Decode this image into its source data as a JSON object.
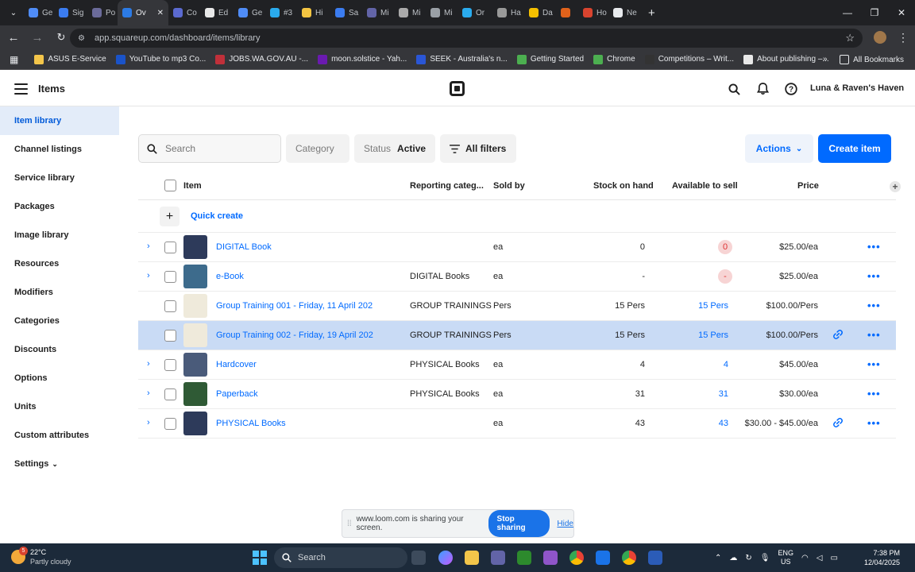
{
  "browser": {
    "tabs": [
      {
        "label": "Ge",
        "color": "#4f8cf7"
      },
      {
        "label": "Sig",
        "color": "#3b7cf0"
      },
      {
        "label": "Po",
        "color": "#6b6b9a"
      },
      {
        "label": "Ov",
        "color": "#2c7be5",
        "active": true
      },
      {
        "label": "Co",
        "color": "#5b6ad0"
      },
      {
        "label": "Ed",
        "color": "#e8e8e8"
      },
      {
        "label": "Ge",
        "color": "#4f8cf7"
      },
      {
        "label": "#3",
        "color": "#2aabee"
      },
      {
        "label": "Hi",
        "color": "#f4c542"
      },
      {
        "label": "Sa",
        "color": "#3b7cf0"
      },
      {
        "label": "Mi",
        "color": "#6264a7"
      },
      {
        "label": "Mi",
        "color": "#aaaaaa"
      },
      {
        "label": "Mi",
        "color": "#9aa0a6"
      },
      {
        "label": "Or",
        "color": "#2aabee"
      },
      {
        "label": "Ha",
        "color": "#999999"
      },
      {
        "label": "Da",
        "color": "#f5c000"
      },
      {
        "label": "",
        "color": "#e0621b"
      },
      {
        "label": "Ho",
        "color": "#d9442f"
      },
      {
        "label": "Ne",
        "color": "#e8eaed"
      }
    ],
    "new_tab": "+",
    "window_controls": [
      "—",
      "❐",
      "✕"
    ],
    "url": "app.squareup.com/dashboard/items/library",
    "bookmarks": [
      {
        "label": "ASUS E-Service",
        "icon": "folder-icon",
        "color": "#f3c54a"
      },
      {
        "label": "YouTube to mp3 Co...",
        "icon": "app-icon",
        "color": "#1a53c9"
      },
      {
        "label": "JOBS.WA.GOV.AU -...",
        "icon": "wa-icon",
        "color": "#c0303a"
      },
      {
        "label": "moon.solstice - Yah...",
        "icon": "yahoo-icon",
        "color": "#6a1ab0"
      },
      {
        "label": "SEEK - Australia's n...",
        "icon": "seek-icon",
        "color": "#2a56d6"
      },
      {
        "label": "Getting Started",
        "icon": "chrome-icon",
        "color": "#4caf50"
      },
      {
        "label": "Chrome",
        "icon": "chrome-icon",
        "color": "#4caf50"
      },
      {
        "label": "Competitions – Writ...",
        "icon": "comp-icon",
        "color": "#333333"
      },
      {
        "label": "About publishing –...",
        "icon": "pub-icon",
        "color": "#e8e8e8"
      }
    ],
    "bookmarks_overflow": "»",
    "all_bookmarks": "All Bookmarks"
  },
  "header": {
    "title": "Items",
    "business_name": "Luna & Raven's Haven"
  },
  "sidebar": {
    "items": [
      {
        "label": "Item library",
        "active": true
      },
      {
        "label": "Channel listings"
      },
      {
        "label": "Service library"
      },
      {
        "label": "Packages"
      },
      {
        "label": "Image library"
      },
      {
        "label": "Resources"
      },
      {
        "label": "Modifiers"
      },
      {
        "label": "Categories"
      },
      {
        "label": "Discounts"
      },
      {
        "label": "Options"
      },
      {
        "label": "Units"
      },
      {
        "label": "Custom attributes"
      },
      {
        "label": "Settings",
        "caret": "⌄"
      }
    ]
  },
  "toolbar": {
    "search_placeholder": "Search",
    "category_label": "Category",
    "status_label": "Status",
    "status_value": "Active",
    "all_filters_label": "All filters",
    "actions_label": "Actions",
    "create_label": "Create item"
  },
  "table": {
    "columns": {
      "item": "Item",
      "reporting": "Reporting categ...",
      "sold_by": "Sold by",
      "stock": "Stock on hand",
      "available": "Available to sell",
      "price": "Price"
    },
    "quick_create": "Quick create",
    "rows": [
      {
        "name": "DIGITAL Book",
        "expandable": true,
        "reporting": "",
        "sold_by": "ea",
        "stock": "0",
        "available": "0",
        "available_badge": true,
        "price": "$25.00/ea",
        "linked": false,
        "thumb_color": "#2d3a5a"
      },
      {
        "name": "e-Book",
        "expandable": true,
        "reporting": "DIGITAL Books",
        "sold_by": "ea",
        "stock": "-",
        "available": "-",
        "available_badge": true,
        "price": "$25.00/ea",
        "linked": false,
        "thumb_color": "#3d6b8c"
      },
      {
        "name": "Group Training 001 - Friday, 11 April 202",
        "expandable": false,
        "reporting": "GROUP TRAININGS",
        "sold_by": "Pers",
        "stock": "15 Pers",
        "available": "15 Pers",
        "available_badge": false,
        "price": "$100.00/Pers",
        "linked": false,
        "thumb_color": "#efeadb"
      },
      {
        "name": "Group Training 002 - Friday, 19 April 202",
        "expandable": false,
        "reporting": "GROUP TRAININGS",
        "sold_by": "Pers",
        "stock": "15 Pers",
        "available": "15 Pers",
        "available_badge": false,
        "price": "$100.00/Pers",
        "linked": true,
        "selected": true,
        "thumb_color": "#efeadb"
      },
      {
        "name": "Hardcover",
        "expandable": true,
        "reporting": "PHYSICAL Books",
        "sold_by": "ea",
        "stock": "4",
        "available": "4",
        "available_badge": false,
        "price": "$45.00/ea",
        "linked": false,
        "thumb_color": "#4a5b7a"
      },
      {
        "name": "Paperback",
        "expandable": true,
        "reporting": "PHYSICAL Books",
        "sold_by": "ea",
        "stock": "31",
        "available": "31",
        "available_badge": false,
        "price": "$30.00/ea",
        "linked": false,
        "thumb_color": "#2f5a35"
      },
      {
        "name": "PHYSICAL Books",
        "expandable": true,
        "reporting": "",
        "sold_by": "ea",
        "stock": "43",
        "available": "43",
        "available_badge": false,
        "price": "$30.00 - $45.00/ea",
        "linked": true,
        "thumb_color": "#2d3a5a"
      }
    ]
  },
  "loom": {
    "message": "www.loom.com is sharing your screen.",
    "stop_label": "Stop sharing",
    "hide_label": "Hide"
  },
  "taskbar": {
    "weather_badge": "5",
    "temperature": "22°C",
    "condition": "Partly cloudy",
    "search_label": "Search",
    "lang_1": "ENG",
    "lang_2": "US",
    "time": "7:38 PM",
    "date": "12/04/2025"
  }
}
